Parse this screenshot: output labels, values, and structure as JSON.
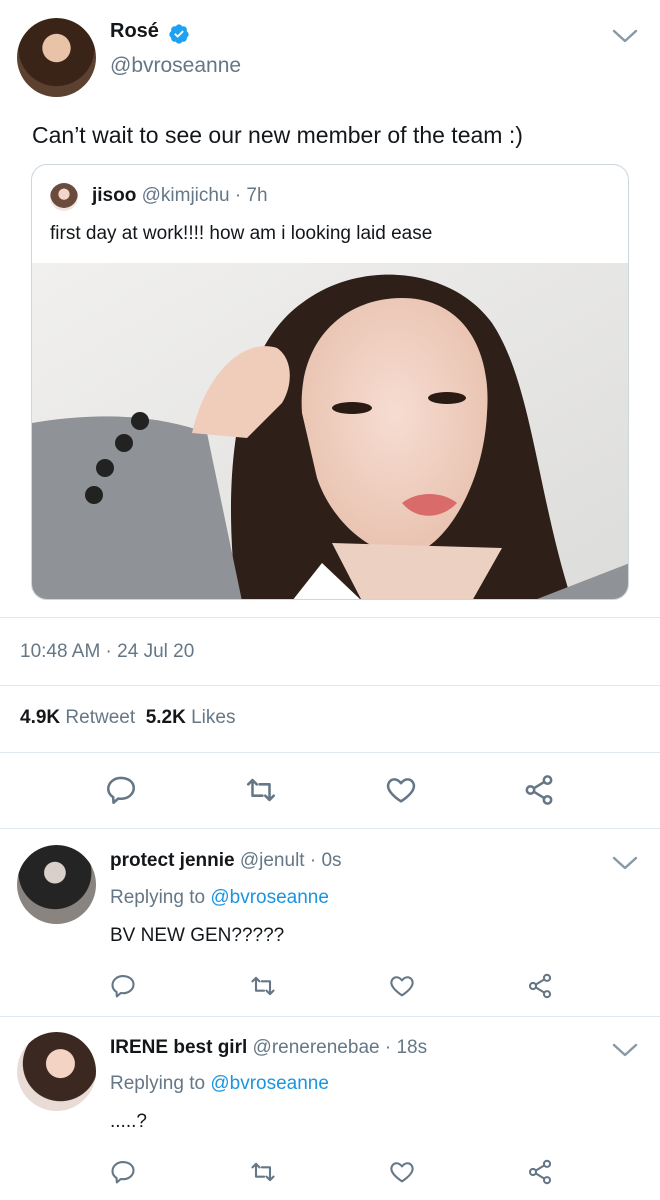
{
  "main_tweet": {
    "display_name": "Rosé",
    "handle": "@bvroseanne",
    "text": "Can’t wait to see our new member of the team :)",
    "quoted": {
      "name": "jisoo",
      "handle": "@kimjichu",
      "time": "· 7h",
      "text": "first day at work!!!! how am i looking laid ease"
    },
    "timestamp": "10:48 AM · 24 Jul 20",
    "retweets_count": "4.9K",
    "retweets_label": "Retweet",
    "likes_count": "5.2K",
    "likes_label": "Likes"
  },
  "replies": [
    {
      "name": "protect jennie",
      "handle": "@jenult",
      "time": "· 0s",
      "replying_prefix": "Replying to",
      "replying_to": "@bvroseanne",
      "text": "BV NEW GEN?????"
    },
    {
      "name": "IRENE best girl",
      "handle": "@renerenebae",
      "time": "· 18s",
      "replying_prefix": "Replying to",
      "replying_to": "@bvroseanne",
      "text": ".....?"
    }
  ],
  "colors": {
    "link": "#1b95e0",
    "muted": "#657786",
    "verified": "#1da1f2",
    "divider": "#e1e8ed"
  }
}
